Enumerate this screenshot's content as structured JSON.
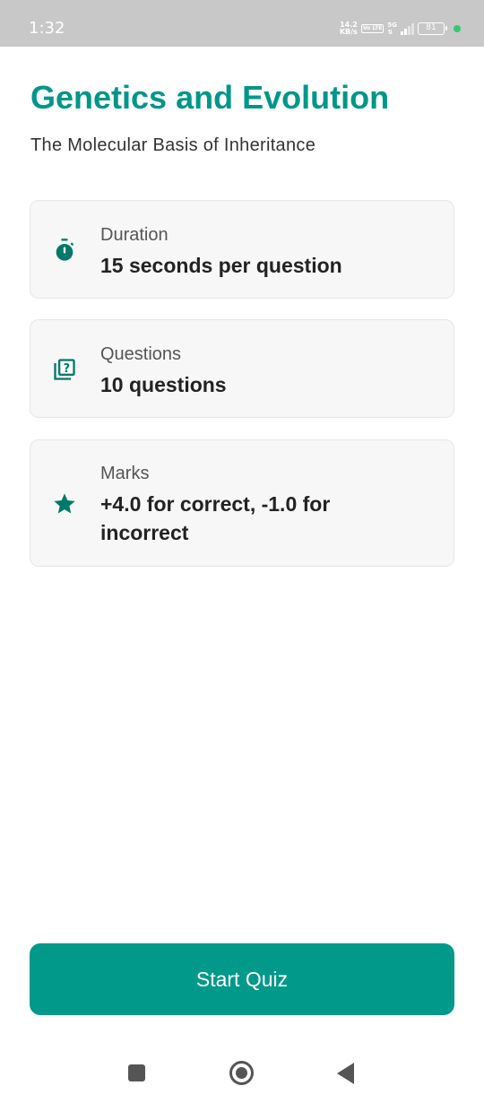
{
  "status_bar": {
    "time": "1:32",
    "net_speed_value": "14.2",
    "net_speed_unit": "KB/s",
    "volte": "Vo LTE",
    "network": "5G",
    "battery": "81"
  },
  "header": {
    "title": "Genetics and Evolution",
    "subtitle": "The Molecular Basis of Inheritance"
  },
  "cards": [
    {
      "icon": "stopwatch-icon",
      "label": "Duration",
      "value": "15 seconds per question"
    },
    {
      "icon": "question-library-icon",
      "label": "Questions",
      "value": "10 questions"
    },
    {
      "icon": "star-icon",
      "label": "Marks",
      "value": "+4.0 for correct, -1.0 for incorrect"
    }
  ],
  "start_button": {
    "label": "Start Quiz"
  },
  "colors": {
    "accent": "#00968a",
    "button": "#00998a",
    "card_bg": "#f7f7f7"
  }
}
